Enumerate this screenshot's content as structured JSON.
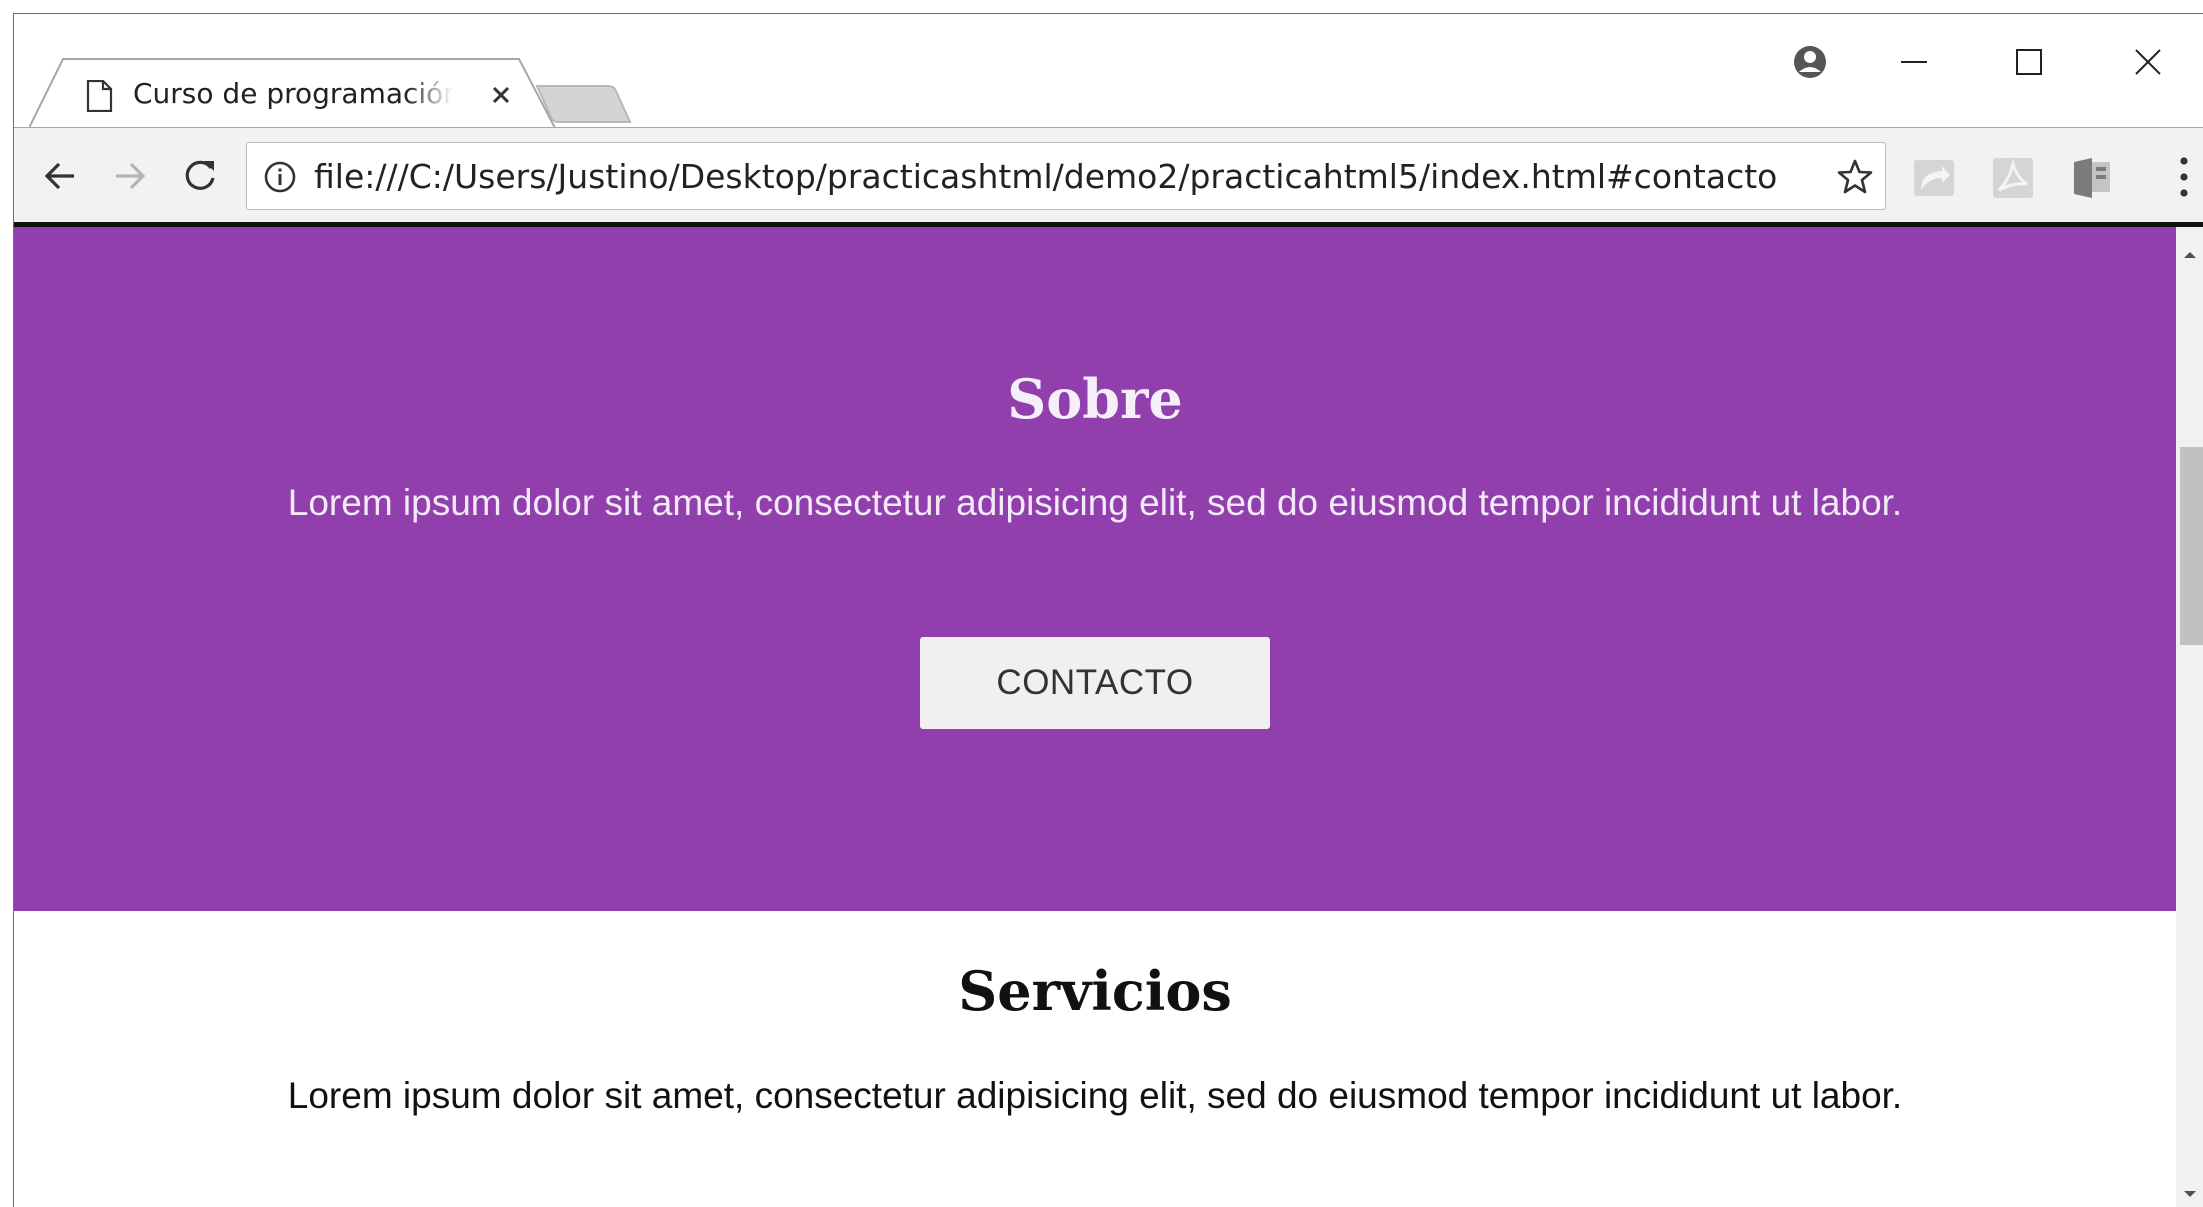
{
  "browser": {
    "tab": {
      "title": "Curso de programación web",
      "doc_icon": "document-icon",
      "close_icon": "close-icon"
    },
    "new_tab_icon": "new-tab-icon",
    "window_controls": [
      "account-icon",
      "minimize-icon",
      "maximize-icon",
      "close-icon"
    ],
    "toolbar": {
      "back_icon": "back-arrow-icon",
      "forward_icon": "forward-arrow-icon",
      "reload_icon": "reload-icon",
      "info_icon": "info-icon",
      "url": "file:///C:/Users/Justino/Desktop/practicashtml/demo2/practicahtml5/index.html#contacto",
      "bookmark_icon": "star-icon",
      "extensions": [
        "cast-extension-icon",
        "pdf-extension-icon",
        "reader-extension-icon"
      ],
      "menu_icon": "more-vert-icon"
    }
  },
  "page": {
    "sobre": {
      "title": "Sobre",
      "text": "Lorem ipsum dolor sit amet, consectetur adipisicing elit, sed do eiusmod tempor incididunt ut labor.",
      "button_label": "CONTACTO"
    },
    "servicios": {
      "title": "Servicios",
      "text": "Lorem ipsum dolor sit amet, consectetur adipisicing elit, sed do eiusmod tempor incididunt ut labor."
    }
  },
  "colors": {
    "sobre_background": "#913fad",
    "button_background": "#f0f0f0",
    "window_border": "#2b79d8"
  }
}
